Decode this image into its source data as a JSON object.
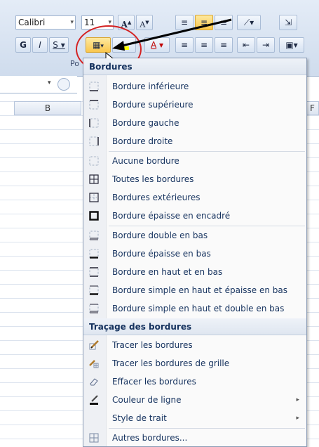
{
  "ribbon": {
    "font_name": "Calibri",
    "font_size": "11",
    "grow_font": "A",
    "shrink_font": "A",
    "bold": "G",
    "italic": "I",
    "underline": "S",
    "font_color_letter": "A",
    "group_label_fragment": "Po"
  },
  "sheet": {
    "col_b": "B",
    "col_f": "F"
  },
  "menu": {
    "header_borders": "Bordures",
    "header_drawing": "Traçage des bordures",
    "items": [
      {
        "label": "Bordure inférieure",
        "icon": "border-bottom-icon"
      },
      {
        "label": "Bordure supérieure",
        "icon": "border-top-icon"
      },
      {
        "label": "Bordure gauche",
        "icon": "border-left-icon"
      },
      {
        "label": "Bordure droite",
        "icon": "border-right-icon"
      },
      {
        "label": "Aucune bordure",
        "icon": "no-border-icon"
      },
      {
        "label": "Toutes les bordures",
        "icon": "all-borders-icon"
      },
      {
        "label": "Bordures extérieures",
        "icon": "outside-borders-icon"
      },
      {
        "label": "Bordure épaisse en encadré",
        "icon": "thick-box-border-icon"
      },
      {
        "label": "Bordure double en bas",
        "icon": "bottom-double-border-icon"
      },
      {
        "label": "Bordure épaisse en bas",
        "icon": "thick-bottom-border-icon"
      },
      {
        "label": "Bordure en haut et en bas",
        "icon": "top-bottom-border-icon"
      },
      {
        "label": "Bordure simple en haut et épaisse en bas",
        "icon": "top-thick-bottom-border-icon"
      },
      {
        "label": "Bordure simple en haut et double en bas",
        "icon": "top-double-bottom-border-icon"
      }
    ],
    "draw_items": [
      {
        "label": "Tracer les bordures",
        "icon": "draw-border-pencil-icon"
      },
      {
        "label": "Tracer les bordures de grille",
        "icon": "draw-grid-pencil-icon"
      },
      {
        "label": "Effacer les bordures",
        "icon": "eraser-icon"
      },
      {
        "label": "Couleur de ligne",
        "icon": "line-color-icon",
        "submenu": true
      },
      {
        "label": "Style de trait",
        "icon": "",
        "submenu": true
      },
      {
        "label": "Autres bordures...",
        "icon": "more-borders-icon"
      }
    ]
  },
  "colors": {
    "accent_circle": "#d42323",
    "menu_text": "#15325e"
  }
}
